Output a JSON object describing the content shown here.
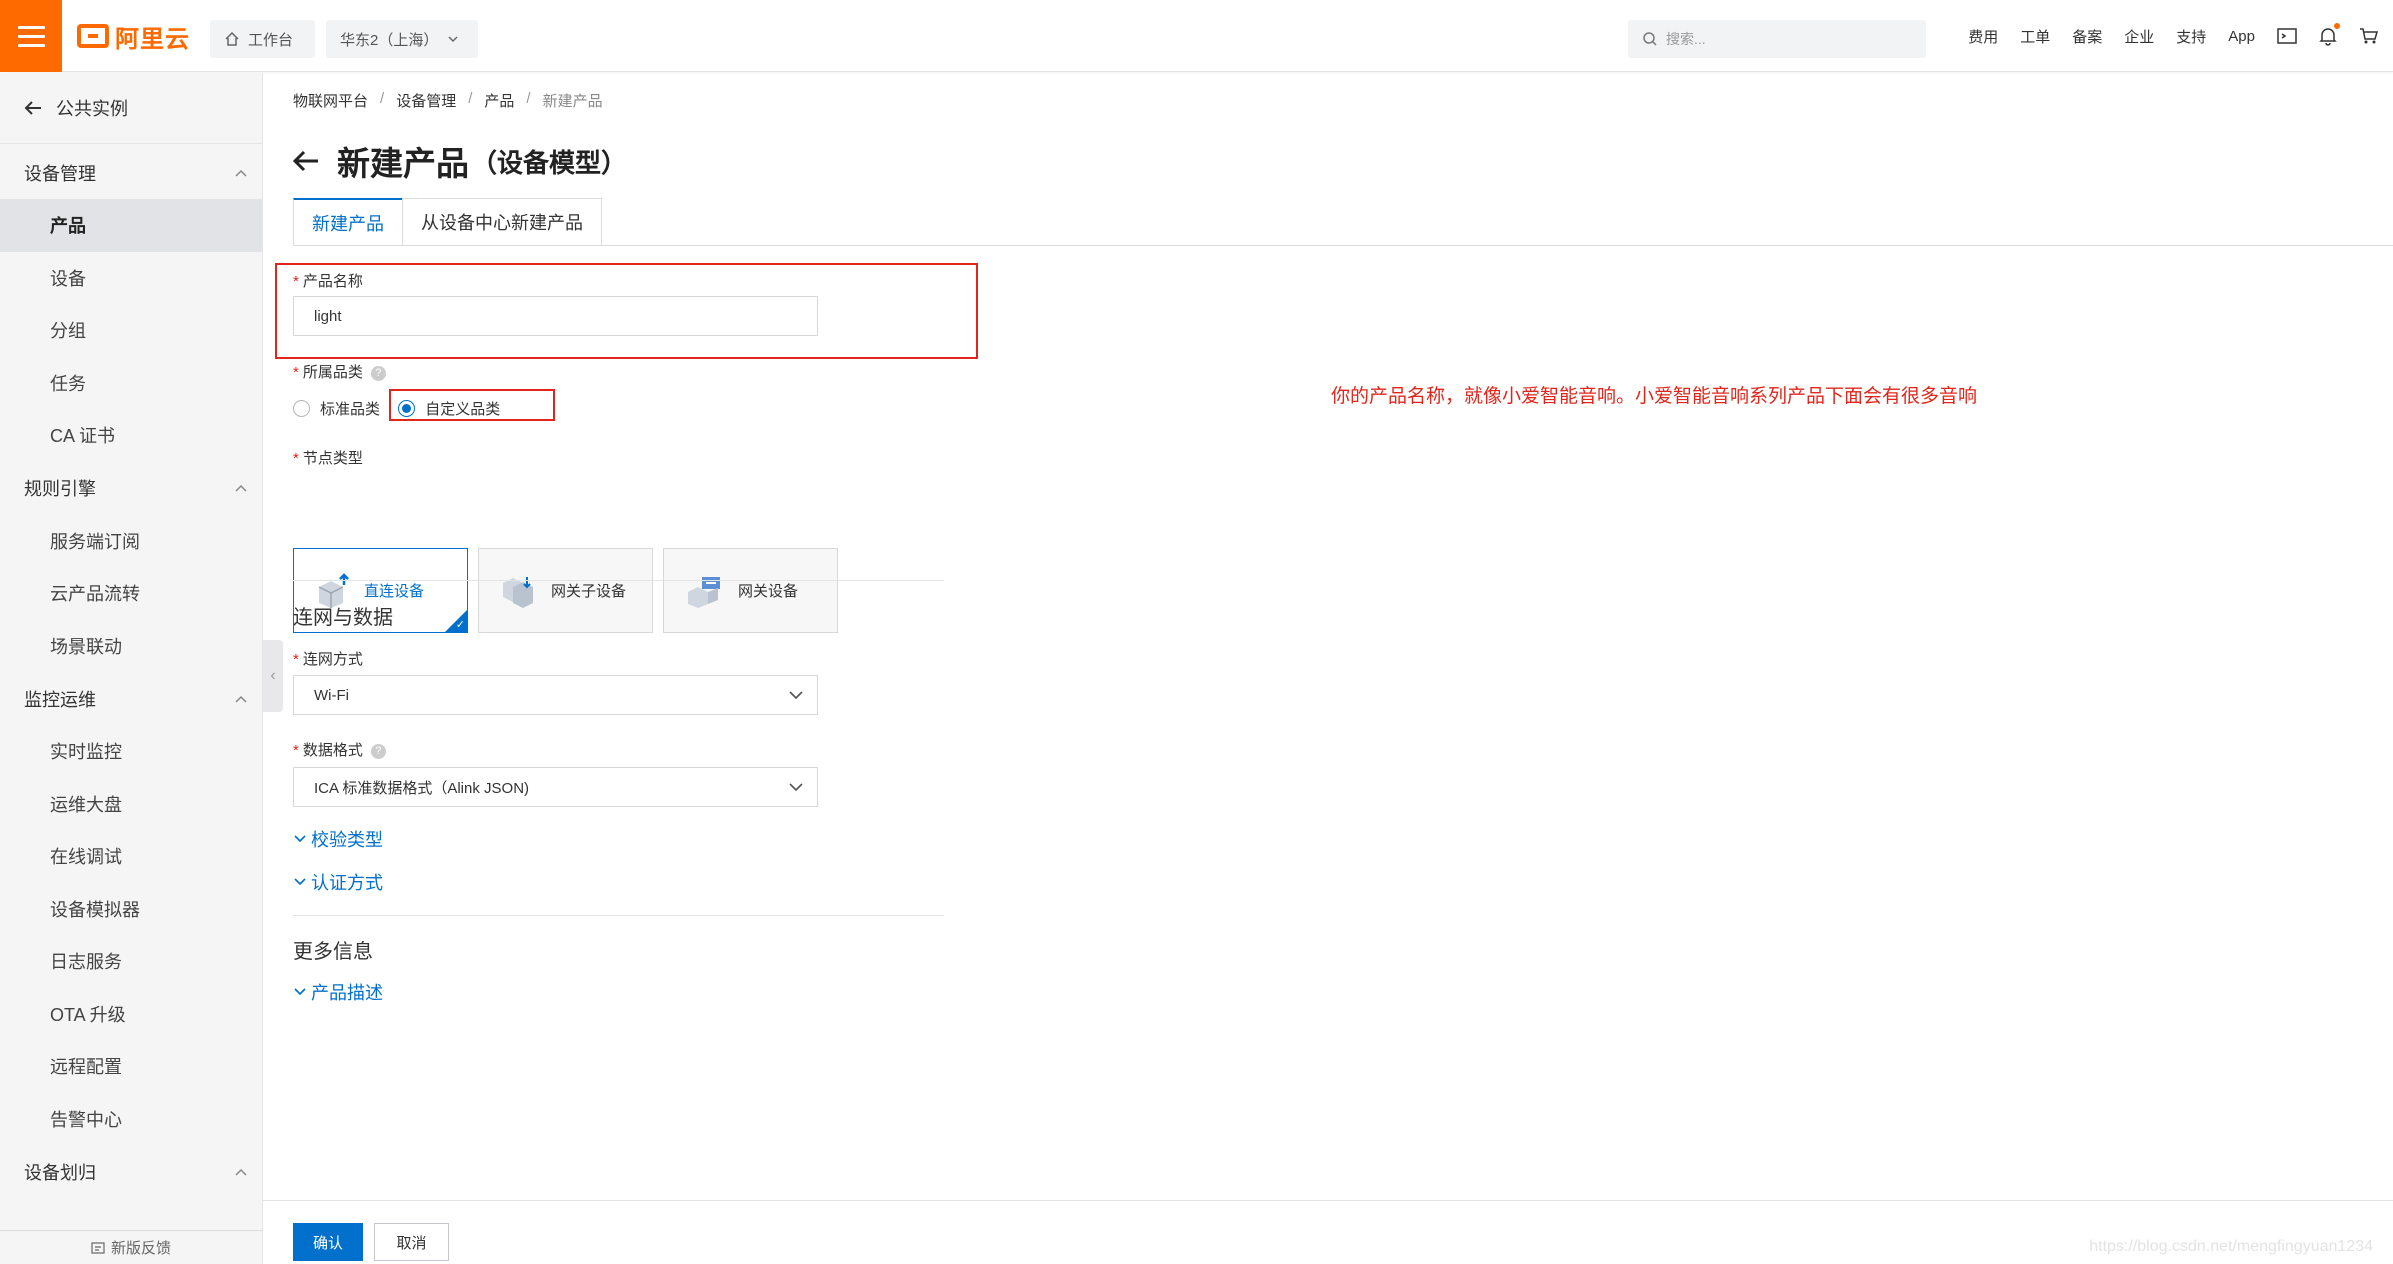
{
  "topbar": {
    "logo_text": "阿里云",
    "workbench": "工作台",
    "region": "华东2（上海）",
    "search_placeholder": "搜索...",
    "links": [
      "费用",
      "工单",
      "备案",
      "企业",
      "支持",
      "App"
    ]
  },
  "sidebar": {
    "back_label": "公共实例",
    "sections": [
      {
        "title": "设备管理",
        "items": [
          "产品",
          "设备",
          "分组",
          "任务",
          "CA 证书"
        ]
      },
      {
        "title": "规则引擎",
        "items": [
          "服务端订阅",
          "云产品流转",
          "场景联动"
        ]
      },
      {
        "title": "监控运维",
        "items": [
          "实时监控",
          "运维大盘",
          "在线调试",
          "设备模拟器",
          "日志服务",
          "OTA 升级",
          "远程配置",
          "告警中心"
        ]
      },
      {
        "title": "设备划归",
        "items": []
      }
    ],
    "active_item": "产品",
    "footer": "新版反馈"
  },
  "breadcrumb": [
    "物联网平台",
    "设备管理",
    "产品",
    "新建产品"
  ],
  "page": {
    "title": "新建产品",
    "title_suffix": "（设备模型）"
  },
  "tabs": [
    "新建产品",
    "从设备中心新建产品"
  ],
  "form": {
    "product_name_label": "产品名称",
    "product_name_value": "light",
    "category_label": "所属品类",
    "category_options": [
      "标准品类",
      "自定义品类"
    ],
    "category_selected": "自定义品类",
    "node_type_label": "节点类型",
    "node_types": [
      "直连设备",
      "网关子设备",
      "网关设备"
    ],
    "node_type_selected": "直连设备",
    "network_section": "连网与数据",
    "connect_label": "连网方式",
    "connect_value": "Wi-Fi",
    "format_label": "数据格式",
    "format_value": "ICA 标准数据格式（Alink JSON)",
    "check_type": "校验类型",
    "auth_method": "认证方式",
    "more_section": "更多信息",
    "description": "产品描述"
  },
  "annotation": "你的产品名称，就像小爱智能音响。小爱智能音响系列产品下面会有很多音响",
  "actions": {
    "confirm": "确认",
    "cancel": "取消"
  },
  "watermark": "https://blog.csdn.net/mengfingyuan1234",
  "colors": {
    "brand": "#ff6a00",
    "primary": "#0070cc",
    "annotation": "#e1251b"
  }
}
